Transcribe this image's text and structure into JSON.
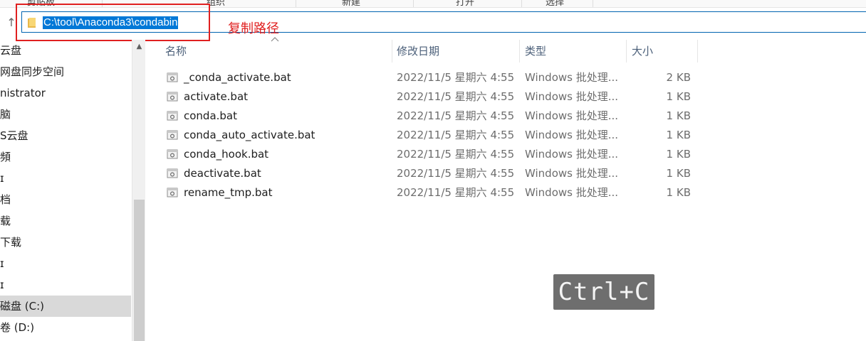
{
  "ribbon": {
    "items": [
      "剪贴板",
      "组织",
      "新建",
      "打开",
      "选择"
    ]
  },
  "address": {
    "path": "C:\\tool\\Anaconda3\\condabin"
  },
  "annotation": {
    "label": "复制路径",
    "color": "#e02020"
  },
  "nav": {
    "items": [
      {
        "label": "云盘"
      },
      {
        "label": "网盘同步空间"
      },
      {
        "label": "nistrator"
      },
      {
        "label": "脑"
      },
      {
        "label": "S云盘"
      },
      {
        "label": "頻"
      },
      {
        "label": "ɪ"
      },
      {
        "label": "档"
      },
      {
        "label": "载"
      },
      {
        "label": "下载"
      },
      {
        "label": "ɪ"
      },
      {
        "label": "ɪ"
      },
      {
        "label": "磁盘 (C:)"
      },
      {
        "label": "卷 (D:)"
      }
    ],
    "selected_index": 12
  },
  "columns": {
    "name": "名称",
    "date": "修改日期",
    "type": "类型",
    "size": "大小"
  },
  "files": [
    {
      "name": "_conda_activate.bat",
      "date": "2022/11/5 星期六 4:55",
      "type": "Windows 批处理...",
      "size": "2 KB"
    },
    {
      "name": "activate.bat",
      "date": "2022/11/5 星期六 4:55",
      "type": "Windows 批处理...",
      "size": "1 KB"
    },
    {
      "name": "conda.bat",
      "date": "2022/11/5 星期六 4:55",
      "type": "Windows 批处理...",
      "size": "1 KB"
    },
    {
      "name": "conda_auto_activate.bat",
      "date": "2022/11/5 星期六 4:55",
      "type": "Windows 批处理...",
      "size": "1 KB"
    },
    {
      "name": "conda_hook.bat",
      "date": "2022/11/5 星期六 4:55",
      "type": "Windows 批处理...",
      "size": "1 KB"
    },
    {
      "name": "deactivate.bat",
      "date": "2022/11/5 星期六 4:55",
      "type": "Windows 批处理...",
      "size": "1 KB"
    },
    {
      "name": "rename_tmp.bat",
      "date": "2022/11/5 星期六 4:55",
      "type": "Windows 批处理...",
      "size": "1 KB"
    }
  ],
  "shortcut": {
    "label": "Ctrl+C"
  },
  "icons": {
    "up": "up-arrow-icon",
    "folder": "folder-icon",
    "file": "batch-file-icon",
    "sort": "sort-chevron-icon"
  }
}
